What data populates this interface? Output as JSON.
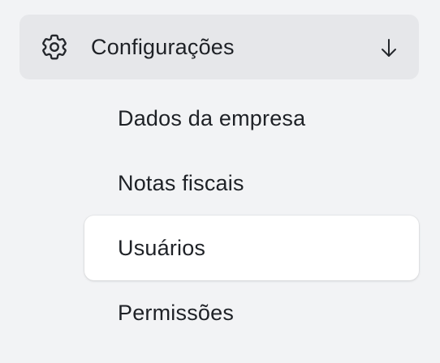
{
  "nav": {
    "group": {
      "label": "Configurações",
      "icon": "gear-icon",
      "toggle_icon": "arrow-down-icon",
      "expanded": true
    },
    "items": [
      {
        "label": "Dados da empresa",
        "active": false
      },
      {
        "label": "Notas fiscais",
        "active": false
      },
      {
        "label": "Usuários",
        "active": true
      },
      {
        "label": "Permissões",
        "active": false
      }
    ]
  },
  "colors": {
    "background": "#f2f3f5",
    "group_header_bg": "#e6e7ea",
    "active_item_bg": "#ffffff",
    "text": "#1e2126"
  }
}
